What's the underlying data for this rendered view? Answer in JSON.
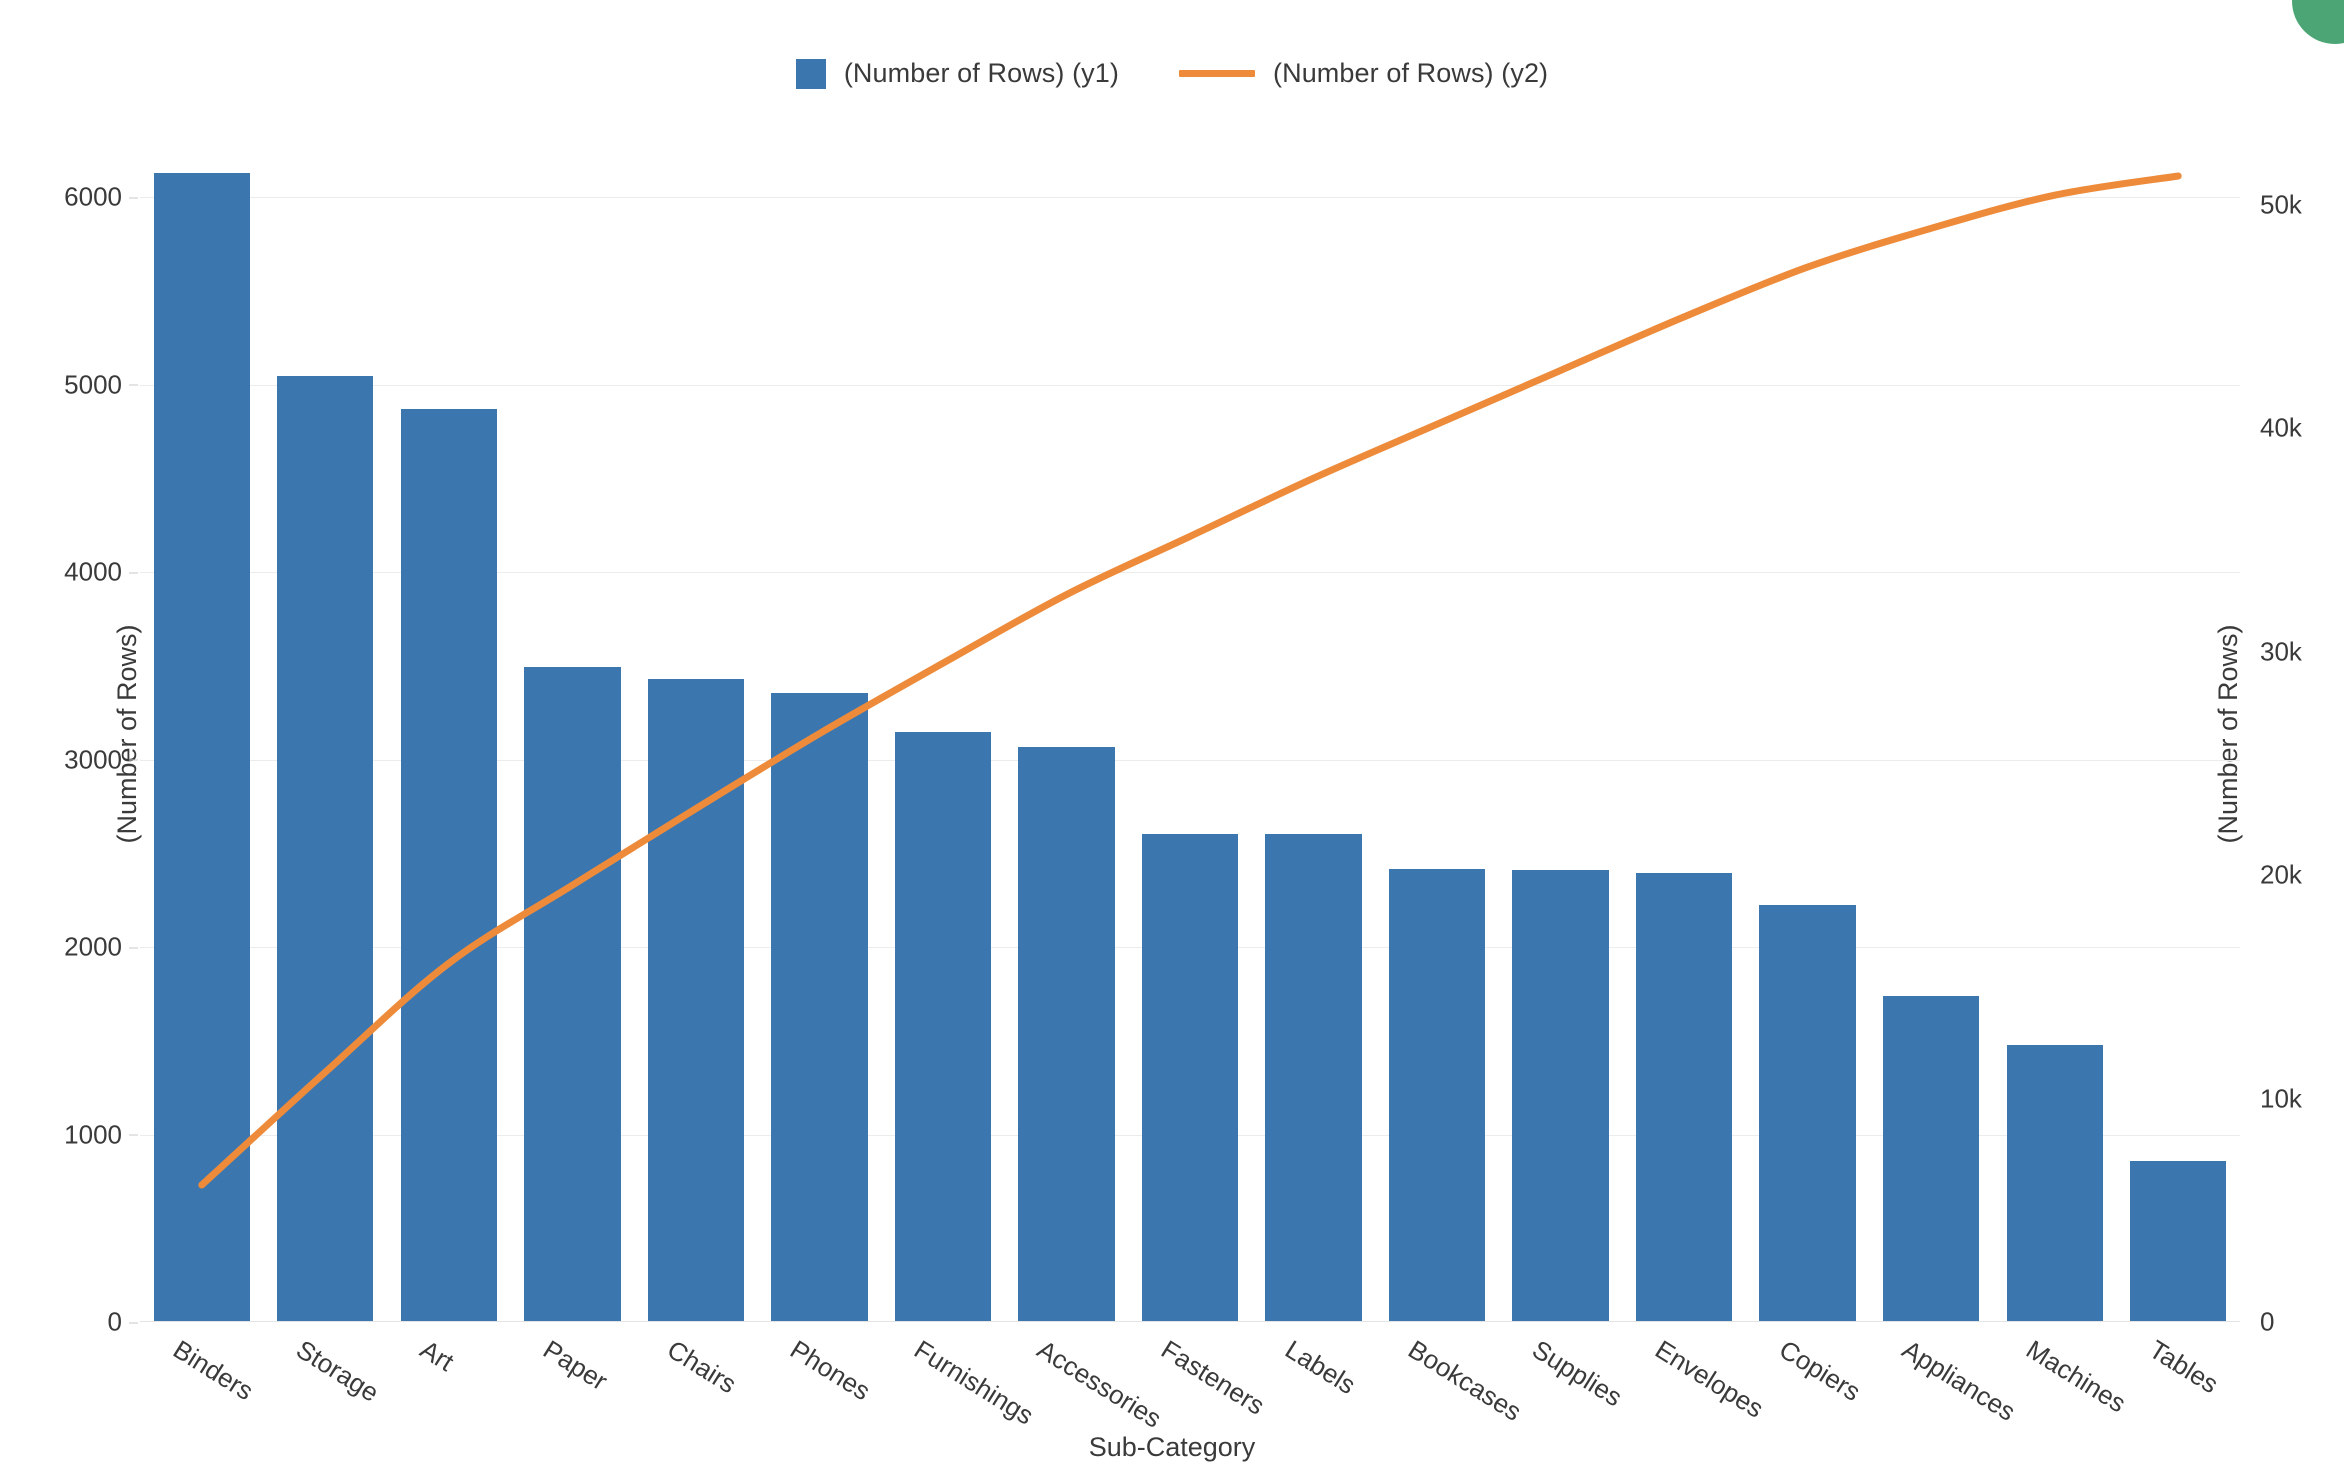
{
  "legend": {
    "entries": [
      {
        "label": "(Number of Rows) (y1)",
        "type": "bar",
        "color": "#3C76AF"
      },
      {
        "label": "(Number of Rows) (y2)",
        "type": "line",
        "color": "#ED8B3A"
      }
    ]
  },
  "axes": {
    "x_title": "Sub-Category",
    "y_left_title": "(Number of Rows)",
    "y_right_title": "(Number of Rows)",
    "y_left_ticks": [
      "0",
      "1000",
      "2000",
      "3000",
      "4000",
      "5000",
      "6000"
    ],
    "y_right_ticks": [
      "0",
      "10k",
      "20k",
      "30k",
      "40k",
      "50k"
    ]
  },
  "colors": {
    "bar": "#3C76AF",
    "line": "#ED8B3A",
    "grid": "#ececec",
    "text": "#3a3a3a",
    "background": "#ffffff",
    "corner_badge": "#4CA575"
  },
  "chart_data": {
    "type": "bar",
    "title": "",
    "subtitle": "",
    "xlabel": "Sub-Category",
    "ylabel": "(Number of Rows)",
    "y2label": "(Number of Rows)",
    "ylim": [
      0,
      6200
    ],
    "y2lim": [
      0,
      52000
    ],
    "grid": true,
    "legend_position": "top-center",
    "categories": [
      "Binders",
      "Storage",
      "Art",
      "Paper",
      "Chairs",
      "Phones",
      "Furnishings",
      "Accessories",
      "Fasteners",
      "Labels",
      "Bookcases",
      "Supplies",
      "Envelopes",
      "Copiers",
      "Appliances",
      "Machines",
      "Tables"
    ],
    "series": [
      {
        "name": "(Number of Rows) (y1)",
        "type": "bar",
        "axis": "y1",
        "color": "#3C76AF",
        "values": [
          6130,
          5050,
          4870,
          3495,
          3430,
          3355,
          3150,
          3070,
          2605,
          2605,
          2415,
          2410,
          2395,
          2225,
          1740,
          1480,
          860
        ]
      },
      {
        "name": "(Number of Rows) (y2)",
        "type": "line",
        "axis": "y2",
        "color": "#ED8B3A",
        "values": [
          6130,
          11180,
          16050,
          19545,
          22975,
          26330,
          29480,
          32550,
          35155,
          37760,
          40175,
          42585,
          44980,
          47205,
          48945,
          50425,
          51285
        ]
      }
    ]
  }
}
